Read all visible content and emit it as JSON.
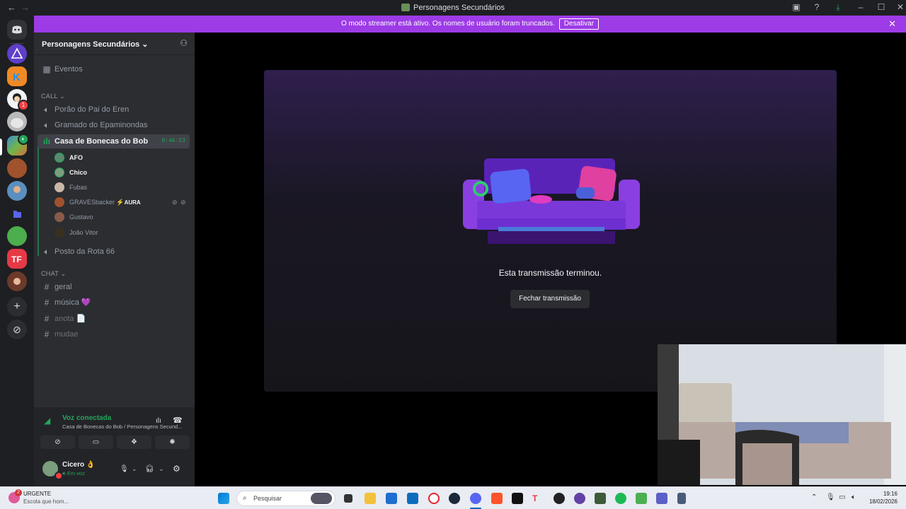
{
  "window": {
    "title": "Personagens Secundários"
  },
  "banner": {
    "message": "O modo streamer está ativo. Os nomes de usuário foram truncados.",
    "button": "Desativar"
  },
  "guild": {
    "name": "Personagens Secundários"
  },
  "sidebar": {
    "events": "Eventos",
    "call_category": "CALL",
    "voice_channels": [
      {
        "name": "Porão do Pai do Eren"
      },
      {
        "name": "Gramado do Epaminondas"
      },
      {
        "name": "Casa de Bonecas do Bob",
        "timer": "9:46:53"
      },
      {
        "name": "Posto da Rota 66"
      }
    ],
    "members": [
      {
        "name": "AFO",
        "color": "#5b8a6e"
      },
      {
        "name": "Chico",
        "color": "#7a9e7e"
      },
      {
        "name": "Fubas",
        "color": "#c9b8a6"
      },
      {
        "name": "GRAVESbacker",
        "tag": "AURA",
        "color": "#a0522d"
      },
      {
        "name": "Gustavo",
        "color": "#8a5a4a"
      },
      {
        "name": "João Vitor",
        "color": "#3a3020"
      }
    ],
    "chat_category": "CHAT",
    "text_channels": [
      {
        "name": "geral"
      },
      {
        "name": "música 💜"
      },
      {
        "name": "anota 📄"
      },
      {
        "name": "mudae"
      }
    ]
  },
  "voice": {
    "status": "Voz conectada",
    "location": "Casa de Bonecas do Bob / Personagens Secund..."
  },
  "user": {
    "name": "Cicero 👌",
    "status": "Em voz"
  },
  "stream": {
    "ended_text": "Esta transmissão terminou.",
    "close_button": "Fechar transmissão"
  },
  "taskbar": {
    "news_badge": "2",
    "news_title": "URGENTE",
    "news_sub": "Escola que hom...",
    "search_placeholder": "Pesquisar",
    "time": "19:16",
    "date": "18/02/2026"
  },
  "colors": {
    "accent": "#9d3be6",
    "voice_green": "#23a55a",
    "sidebar_bg": "#2b2d31"
  }
}
